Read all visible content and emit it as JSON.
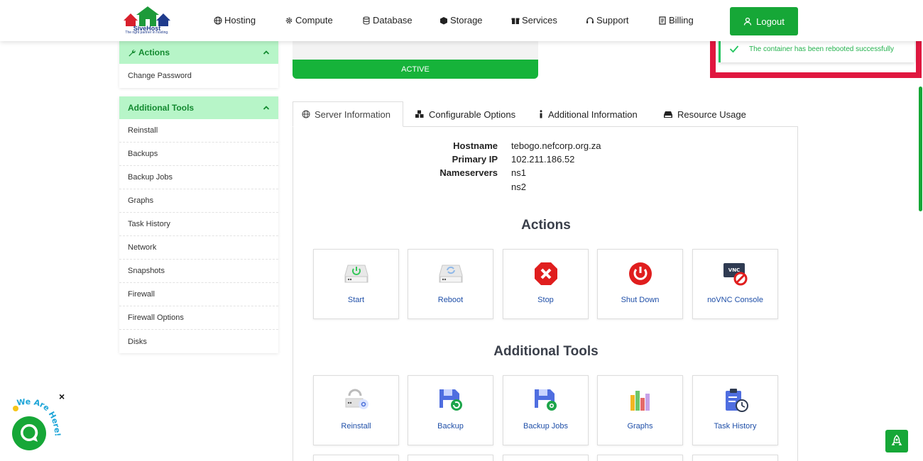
{
  "brand": {
    "name": "SiveHost",
    "tagline": "The right partner in hosting."
  },
  "nav": {
    "items": [
      {
        "label": "Hosting",
        "icon": "globe-icon"
      },
      {
        "label": "Compute",
        "icon": "gear-icon"
      },
      {
        "label": "Database",
        "icon": "database-icon"
      },
      {
        "label": "Storage",
        "icon": "cube-icon"
      },
      {
        "label": "Services",
        "icon": "gift-icon"
      },
      {
        "label": "Support",
        "icon": "headset-icon"
      },
      {
        "label": "Billing",
        "icon": "invoice-icon"
      }
    ],
    "logout_label": "Logout"
  },
  "sidebar": {
    "actions": {
      "title": "Actions",
      "items": [
        "Change Password"
      ]
    },
    "tools": {
      "title": "Additional Tools",
      "items": [
        "Reinstall",
        "Backups",
        "Backup Jobs",
        "Graphs",
        "Task History",
        "Network",
        "Snapshots",
        "Firewall",
        "Firewall Options",
        "Disks"
      ]
    }
  },
  "status": {
    "label": "ACTIVE"
  },
  "toast": {
    "message": "The container has been rebooted successfully"
  },
  "tabs": [
    {
      "label": "Server Information",
      "icon": "globe-icon"
    },
    {
      "label": "Configurable Options",
      "icon": "cubes-icon"
    },
    {
      "label": "Additional Information",
      "icon": "info-icon"
    },
    {
      "label": "Resource Usage",
      "icon": "hdd-icon"
    }
  ],
  "server_info": {
    "hostname_label": "Hostname",
    "hostname": "tebogo.nefcorp.org.za",
    "ip_label": "Primary IP",
    "ip": "102.211.186.52",
    "ns_label": "Nameservers",
    "ns1": "ns1",
    "ns2": "ns2"
  },
  "actions_section": {
    "title": "Actions",
    "items": [
      "Start",
      "Reboot",
      "Stop",
      "Shut Down",
      "noVNC Console"
    ],
    "vnc_badge": "VNC"
  },
  "tools_section": {
    "title": "Additional Tools",
    "items": [
      "Reinstall",
      "Backup",
      "Backup Jobs",
      "Graphs",
      "Task History"
    ]
  },
  "chat": {
    "caption": "We Are Here!",
    "close": "×"
  },
  "colors": {
    "primary": "#16a737",
    "accent_light": "#b7f5c8",
    "alert": "#e0173f",
    "link": "#1f4fa8"
  }
}
